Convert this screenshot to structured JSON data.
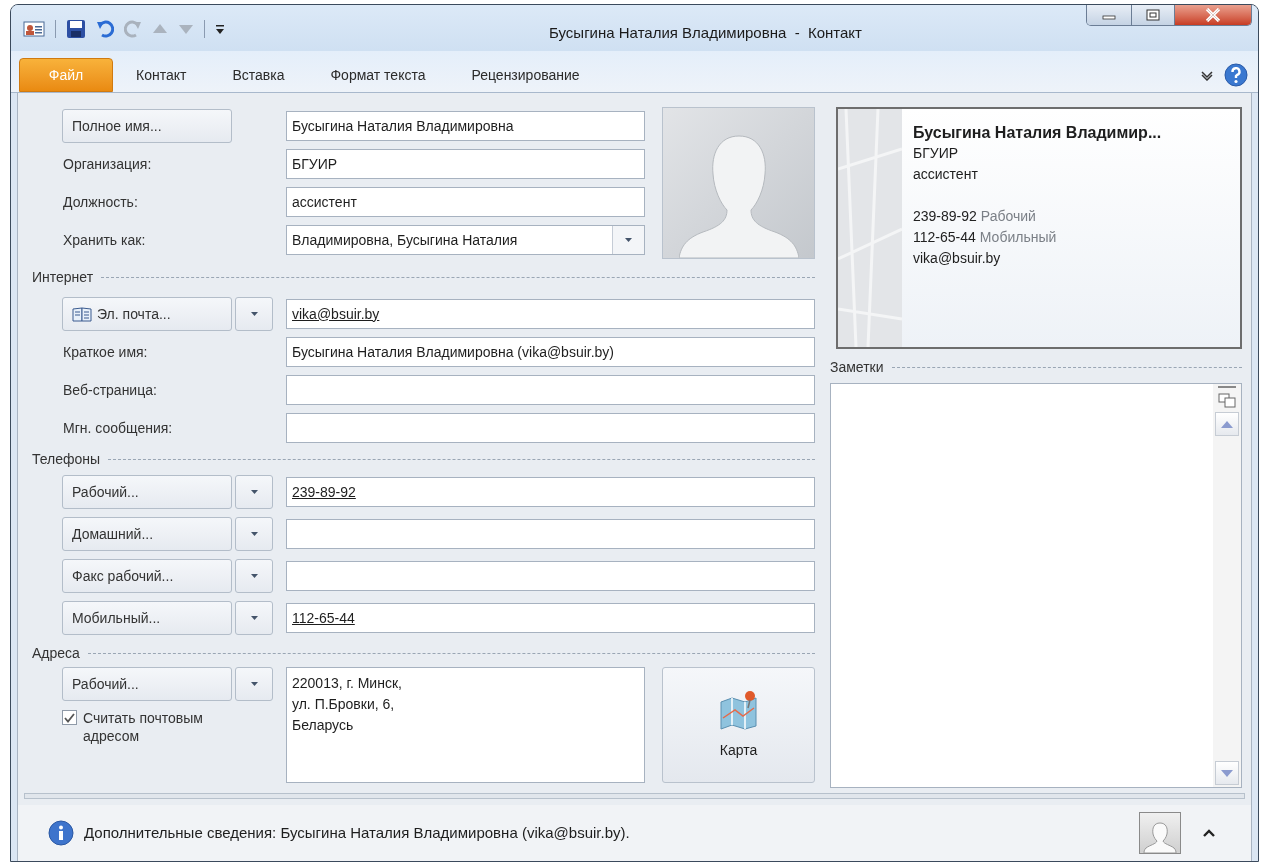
{
  "window": {
    "title": "Бусыгина Наталия Владимировна  -  Контакт"
  },
  "tabs": [
    {
      "label": "Файл",
      "kind": "file"
    },
    {
      "label": "Контакт",
      "kind": "tab"
    },
    {
      "label": "Вставка",
      "kind": "tab"
    },
    {
      "label": "Формат текста",
      "kind": "tab"
    },
    {
      "label": "Рецензирование",
      "kind": "tab"
    }
  ],
  "name_rows": [
    {
      "kind": "button",
      "label": "Полное имя...",
      "value": "Бусыгина Наталия Владимировна"
    },
    {
      "kind": "label",
      "label": "Организация:",
      "value": "БГУИР"
    },
    {
      "kind": "label",
      "label": "Должность:",
      "value": "ассистент"
    },
    {
      "kind": "combo",
      "label": "Хранить как:",
      "value": "Владимировна, Бусыгина Наталия"
    }
  ],
  "internet": {
    "title": "Интернет",
    "rows": [
      {
        "kind": "split_button",
        "label": "Эл. почта...",
        "value": "vika@bsuir.by",
        "link": true
      },
      {
        "kind": "label",
        "label": "Краткое имя:",
        "value": "Бусыгина Наталия Владимировна (vika@bsuir.by)"
      },
      {
        "kind": "label",
        "label": "Веб-страница:"
      },
      {
        "kind": "label",
        "label": "Мгн. сообщения:"
      }
    ]
  },
  "phones": {
    "title": "Телефоны",
    "rows": [
      {
        "kind": "split_button",
        "label": "Рабочий...",
        "value": "239-89-92",
        "link": true
      },
      {
        "kind": "split_button",
        "label": "Домашний..."
      },
      {
        "kind": "split_button",
        "label": "Факс рабочий..."
      },
      {
        "kind": "split_button",
        "label": "Мобильный...",
        "value": "112-65-44",
        "link": true
      }
    ]
  },
  "addresses": {
    "title": "Адреса",
    "type_button": "Рабочий...",
    "mailing_checkbox": {
      "label": "Считать почтовым адресом",
      "checked": true
    },
    "address_lines": [
      "220013, г. Минск,",
      "ул. П.Бровки, 6,",
      "Беларусь"
    ],
    "map_button": "Карта"
  },
  "business_card": {
    "name": "Бусыгина Наталия Владимир...",
    "lines": [
      "БГУИР",
      "ассистент"
    ],
    "phones": [
      {
        "number": "239-89-92",
        "type": "Рабочий"
      },
      {
        "number": "112-65-44",
        "type": "Мобильный"
      }
    ],
    "email": "vika@bsuir.by"
  },
  "notes": {
    "title": "Заметки"
  },
  "status_bar": {
    "text": "Дополнительные сведения: Бусыгина Наталия Владимировна (vika@bsuir.by)."
  }
}
